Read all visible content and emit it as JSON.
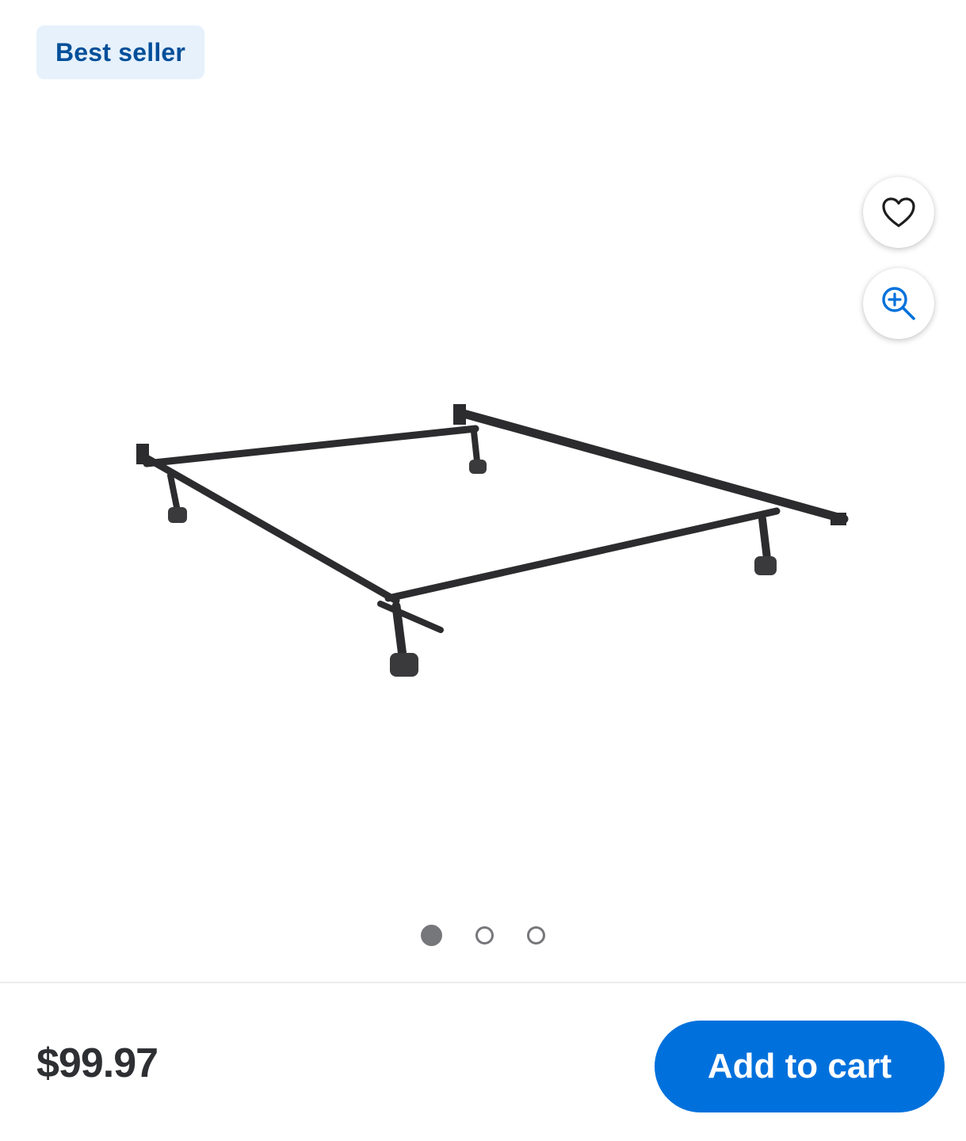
{
  "badge": {
    "label": "Best seller"
  },
  "actions": {
    "favorite_icon": "heart-icon",
    "zoom_icon": "zoom-in-icon"
  },
  "product": {
    "image_name": "bed-frame-image"
  },
  "carousel": {
    "total": 3,
    "active_index": 0
  },
  "footer": {
    "price": "$99.97",
    "add_to_cart_label": "Add to cart"
  },
  "colors": {
    "accent": "#0071dc",
    "badge_bg": "#e6f1fc",
    "badge_text": "#004f9a",
    "price_text": "#2e2f32"
  }
}
